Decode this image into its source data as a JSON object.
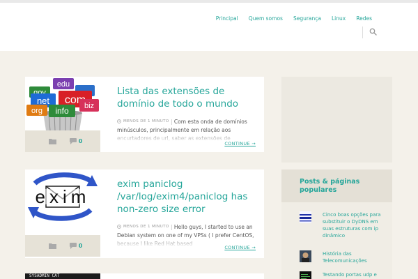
{
  "nav": {
    "items": [
      "Principal",
      "Quem somos",
      "Segurança",
      "Linux",
      "Redes"
    ]
  },
  "posts": [
    {
      "title": "Lista das extensões de domínio de todo o mundo",
      "date": "Menos de 1 minuto",
      "excerpt": "Com esta onda de domínios minúsculos, principalmente em relação aos encurtadores de url, saber as extensões de",
      "comments": "0",
      "continue": "Continue →",
      "thumb_words": [
        "edu",
        "gov",
        "net",
        "com",
        "org",
        "info",
        "biz"
      ]
    },
    {
      "title": "exim paniclog /var/log/exim4/paniclog has non-zero size error",
      "date": "Menos de 1 minuto",
      "excerpt": "Hello guys, I started to use an Debian system on one of my VPSs ( I prefer CentOS, because I like Red Hat based",
      "comments": "0",
      "continue": "Continue →",
      "thumb_word": "exim"
    }
  ],
  "post3": {
    "thumb_text": "SYSADMIN CAT"
  },
  "sidebar": {
    "popular_title": "Posts & páginas populares",
    "popular": [
      "Cinco boas opções para substituir o DyDNS em suas estruturas com ip dinâmico",
      "História das Telecomunicações",
      "Testando portas udp e"
    ]
  },
  "colors": {
    "accent": "#26a69a",
    "background": "#f4f1ea",
    "meta_bar": "#e6e2d7"
  }
}
